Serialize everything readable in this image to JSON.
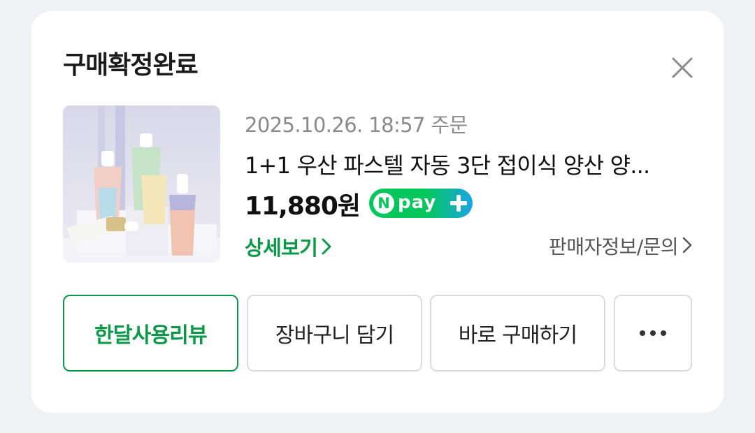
{
  "title": "구매확정완료",
  "close_icon": "close-icon",
  "product": {
    "image_icon": "umbrella-product-image",
    "order_date": "2025.10.26. 18:57 주문",
    "name": "1+1 우산 파스텔 자동 3단 접이식 양산 양...",
    "price": "11,880원",
    "npay": {
      "n": "N",
      "label": "pay",
      "plus_icon": "plus-icon",
      "colors": {
        "green": "#03c75a",
        "blue": "#1aa5e3"
      }
    },
    "detail_link": "상세보기",
    "seller_link": "판매자정보/문의"
  },
  "buttons": {
    "review": "한달사용리뷰",
    "cart": "장바구니 담기",
    "buy": "바로 구매하기",
    "more_icon": "more-dots-icon"
  },
  "colors": {
    "accent": "#0a9a47",
    "background": "#eff1f4"
  }
}
